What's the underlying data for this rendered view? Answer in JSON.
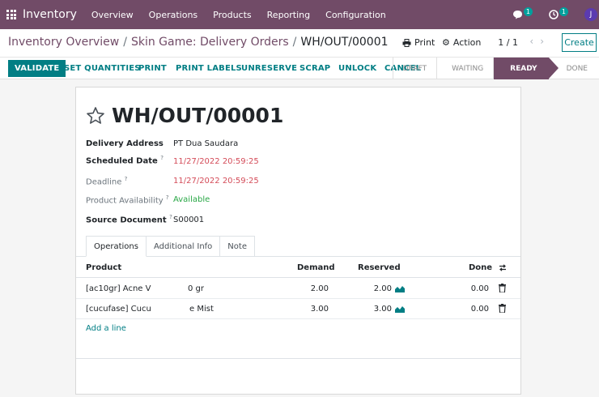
{
  "nav": {
    "app_name": "Inventory",
    "menu": [
      "Overview",
      "Operations",
      "Products",
      "Reporting",
      "Configuration"
    ],
    "messages_count": "1",
    "activities_count": "1",
    "avatar_initial": "J",
    "color": "#714b67"
  },
  "breadcrumb": {
    "items": [
      "Inventory Overview",
      "Skin Game: Delivery Orders",
      "WH/OUT/00001"
    ]
  },
  "control": {
    "print_label": "Print",
    "action_label": "Action",
    "pager": "1 / 1",
    "create_label": "Create"
  },
  "actions": [
    "VALIDATE",
    "SET QUANTITIES",
    "PRINT",
    "PRINT LABELS",
    "UNRESERVE",
    "SCRAP",
    "UNLOCK",
    "CANCEL"
  ],
  "stages": [
    "DRAFT",
    "WAITING",
    "READY",
    "DONE"
  ],
  "active_stage": "READY",
  "record": {
    "title": "WH/OUT/00001",
    "fields": {
      "delivery_address": {
        "label": "Delivery Address",
        "value": "PT Dua Saudara"
      },
      "scheduled_date": {
        "label": "Scheduled Date",
        "value": "11/27/2022 20:59:25"
      },
      "deadline": {
        "label": "Deadline",
        "value": "11/27/2022 20:59:25"
      },
      "availability": {
        "label": "Product Availability",
        "value": "Available"
      },
      "source_document": {
        "label": "Source Document",
        "value": "S00001"
      }
    },
    "help_mark": "?"
  },
  "tabs": [
    "Operations",
    "Additional Info",
    "Note"
  ],
  "table": {
    "headers": {
      "product": "Product",
      "demand": "Demand",
      "reserved": "Reserved",
      "done": "Done"
    },
    "rows": [
      {
        "product_left": "[ac10gr] Acne V",
        "product_right": "0 gr",
        "demand": "2.00",
        "reserved": "2.00",
        "done": "0.00"
      },
      {
        "product_left": "[cucufase] Cucu",
        "product_right": "e Mist",
        "demand": "3.00",
        "reserved": "3.00",
        "done": "0.00"
      }
    ],
    "add_line": "Add a line"
  },
  "colors": {
    "primary": "#714b67",
    "accent": "#017e84",
    "danger": "#d44c59",
    "success": "#28a745"
  }
}
